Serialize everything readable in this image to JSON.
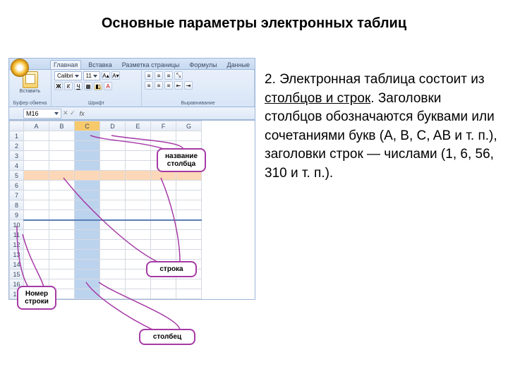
{
  "title": "Основные параметры электронных таблиц",
  "paragraph": {
    "num": "2. ",
    "pre": "Электронная таблица состоит из ",
    "underlined": "столбцов и строк",
    "post": ". Заголовки столбцов обозначаются буквами или сочетаниями букв (A, B, C, AB и т. п.), заголовки строк — числами (1, 6, 56, 310 и т. п.)."
  },
  "ribbon": {
    "tabs": [
      "Главная",
      "Вставка",
      "Разметка страницы",
      "Формулы",
      "Данные"
    ],
    "groups": {
      "clipboard": "Буфер обмена",
      "paste": "Вставить",
      "font": "Шрифт",
      "align": "Выравнивание"
    },
    "font_name": "Calibri",
    "font_size": "11"
  },
  "name_box": "M16",
  "fx_label": "fx",
  "columns": [
    "A",
    "B",
    "C",
    "D",
    "E",
    "F",
    "G"
  ],
  "rows": [
    "1",
    "2",
    "3",
    "4",
    "5",
    "6",
    "7",
    "8",
    "9",
    "10",
    "11",
    "12",
    "13",
    "14",
    "15",
    "16",
    "17"
  ],
  "callouts": {
    "col_name": "название столбца",
    "row_label": "строка",
    "column_label": "столбец",
    "row_num": "Номер строки"
  }
}
